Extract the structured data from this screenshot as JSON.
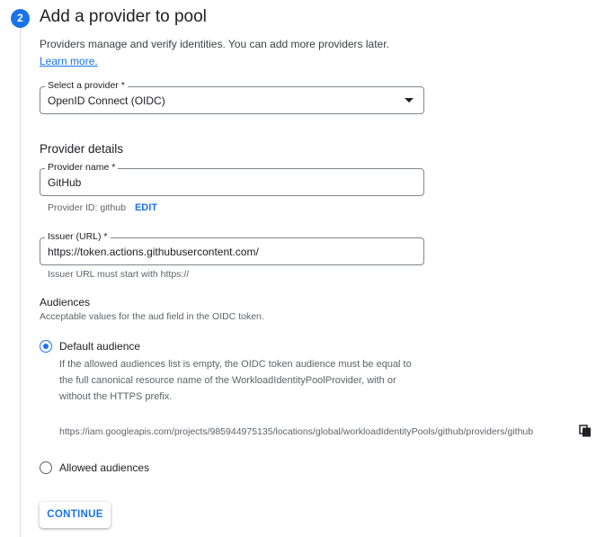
{
  "step": {
    "number": "2",
    "title": "Add a provider to pool",
    "intro_text": "Providers manage and verify identities. You can add more providers later. ",
    "learn_more": "Learn more."
  },
  "provider_select": {
    "label": "Select a provider *",
    "value": "OpenID Connect (OIDC)"
  },
  "provider_details": {
    "heading": "Provider details",
    "name_label": "Provider name *",
    "name_value": "GitHub",
    "provider_id_text": "Provider ID: github",
    "edit_label": "EDIT",
    "issuer_label": "Issuer (URL) *",
    "issuer_value": "https://token.actions.githubusercontent.com/",
    "issuer_hint": "Issuer URL must start with https://"
  },
  "audiences": {
    "title": "Audiences",
    "subtitle": "Acceptable values for the aud field in the OIDC token.",
    "default_label": "Default audience",
    "default_description": "If the allowed audiences list is empty, the OIDC token audience must be equal to the full canonical resource name of the WorkloadIdentityPoolProvider, with or without the HTTPS prefix.",
    "default_url": "https://iam.googleapis.com/projects/985944975135/locations/global/workloadIdentityPools/github/providers/github",
    "allowed_label": "Allowed audiences",
    "selected": "Default audience"
  },
  "actions": {
    "continue_label": "CONTINUE"
  },
  "colors": {
    "accent": "#1a73e8",
    "text": "#202124",
    "muted": "#5f6368"
  },
  "icons": {
    "copy": "copy-icon",
    "dropdown": "chevron-down-icon"
  }
}
